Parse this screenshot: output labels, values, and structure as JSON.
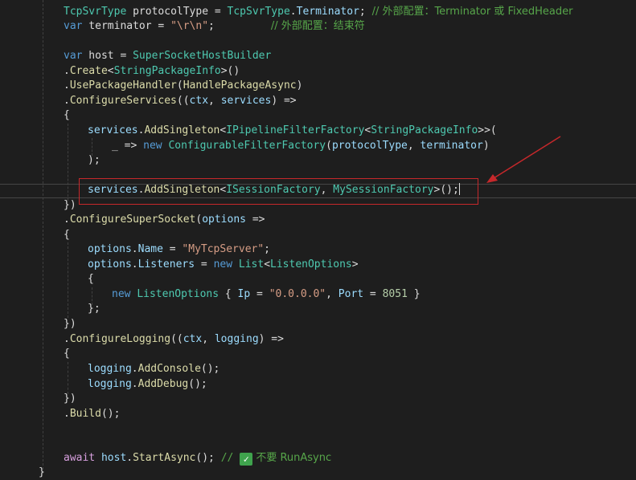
{
  "code": {
    "l1": {
      "a": "TcpSvrType",
      "b": " protocolType = ",
      "c": "TcpSvrType",
      "d": ".",
      "e": "Terminator",
      "f": "; ",
      "g": "// 外部配置：Terminator 或 FixedHeader"
    },
    "l2": {
      "a": "var",
      "b": " terminator = ",
      "c": "\"\\r\\n\"",
      "d": ";",
      "g": "// 外部配置：结束符"
    },
    "l3": {
      "a": "var",
      "b": " host = ",
      "c": "SuperSocketHostBuilder"
    },
    "l4": {
      "a": ".",
      "b": "Create",
      "c": "<",
      "d": "StringPackageInfo",
      "e": ">()"
    },
    "l5": {
      "a": ".",
      "b": "UsePackageHandler",
      "c": "(",
      "d": "HandlePackageAsync",
      "e": ")"
    },
    "l6": {
      "a": ".",
      "b": "ConfigureServices",
      "c": "((",
      "d": "ctx",
      "e": ", ",
      "f": "services",
      "g": ") =>"
    },
    "l7": "{",
    "l8": {
      "a": "services",
      "b": ".",
      "c": "AddSingleton",
      "d": "<",
      "e": "IPipelineFilterFactory",
      "f": "<",
      "g": "StringPackageInfo",
      "h": ">>("
    },
    "l9": {
      "a": "_ => ",
      "b": "new",
      "c": " ",
      "d": "ConfigurableFilterFactory",
      "e": "(",
      "f": "protocolType",
      "g": ", ",
      "h": "terminator",
      "i": ")"
    },
    "l10": ");",
    "l11": {
      "a": "services",
      "b": ".",
      "c": "AddSingleton",
      "d": "<",
      "e": "ISessionFactory",
      "f": ", ",
      "g": "MySessionFactory",
      "h": ">();"
    },
    "l12": "})",
    "l13": {
      "a": ".",
      "b": "ConfigureSuperSocket",
      "c": "(",
      "d": "options",
      "e": " =>"
    },
    "l14": "{",
    "l15": {
      "a": "options",
      "b": ".",
      "c": "Name",
      "d": " = ",
      "e": "\"MyTcpServer\"",
      "f": ";"
    },
    "l16": {
      "a": "options",
      "b": ".",
      "c": "Listeners",
      "d": " = ",
      "e": "new",
      "f": " ",
      "g": "List",
      "h": "<",
      "i": "ListenOptions",
      "j": ">"
    },
    "l17": "{",
    "l18": {
      "a": "new",
      "b": " ",
      "c": "ListenOptions",
      "d": " { ",
      "e": "Ip",
      "f": " = ",
      "g": "\"0.0.0.0\"",
      "h": ", ",
      "i": "Port",
      "j": " = ",
      "k": "8051",
      "l": " }"
    },
    "l19": "};",
    "l20": "})",
    "l21": {
      "a": ".",
      "b": "ConfigureLogging",
      "c": "((",
      "d": "ctx",
      "e": ", ",
      "f": "logging",
      "g": ") =>"
    },
    "l22": "{",
    "l23": {
      "a": "logging",
      "b": ".",
      "c": "AddConsole",
      "d": "();"
    },
    "l24": {
      "a": "logging",
      "b": ".",
      "c": "AddDebug",
      "d": "();"
    },
    "l25": "})",
    "l26": {
      "a": ".",
      "b": "Build",
      "c": "();"
    },
    "l27": {
      "a": "await",
      "b": " ",
      "c": "host",
      "d": ".",
      "e": "StartAsync",
      "f": "(); ",
      "g": "// ",
      "h": "✓",
      "i": " 不要 RunAsync"
    },
    "l28": "}"
  },
  "colors": {
    "highlight_box": "#c6282b",
    "arrow": "#c6282b",
    "check": "#3fa34d"
  }
}
